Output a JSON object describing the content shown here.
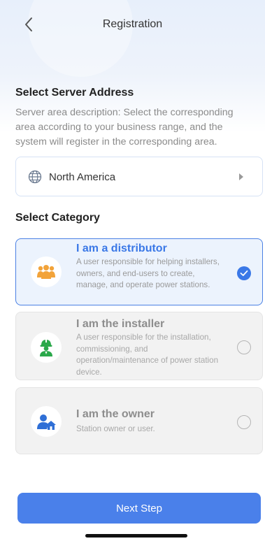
{
  "header": {
    "title": "Registration",
    "back_icon": "chevron-left-icon"
  },
  "server": {
    "section_title": "Select Server Address",
    "description": "Server area description: Select the corresponding area according to your business range, and the system will register in the corresponding area.",
    "selected_region": "North America",
    "icons": [
      "globe-icon",
      "caret-right-icon"
    ]
  },
  "category": {
    "section_title": "Select Category",
    "options": [
      {
        "title": "I am a distributor",
        "description": "A user responsible for helping installers, owners, and end-users to create, manage, and operate power stations.",
        "icon": "distributor-group-icon",
        "selected": true
      },
      {
        "title": "I am the installer",
        "description": "A user responsible for the installation, commissioning, and operation/maintenance of power station device.",
        "icon": "installer-hardhat-icon",
        "selected": false
      },
      {
        "title": "I am the owner",
        "description": "Station owner or user.",
        "icon": "owner-home-icon",
        "selected": false
      }
    ]
  },
  "footer": {
    "next_label": "Next Step"
  },
  "colors": {
    "accent": "#3a78e7",
    "button": "#4a80ea",
    "distributor_icon": "#f2a33a",
    "installer_icon": "#2aa84a",
    "owner_icon": "#2f6fd6"
  }
}
